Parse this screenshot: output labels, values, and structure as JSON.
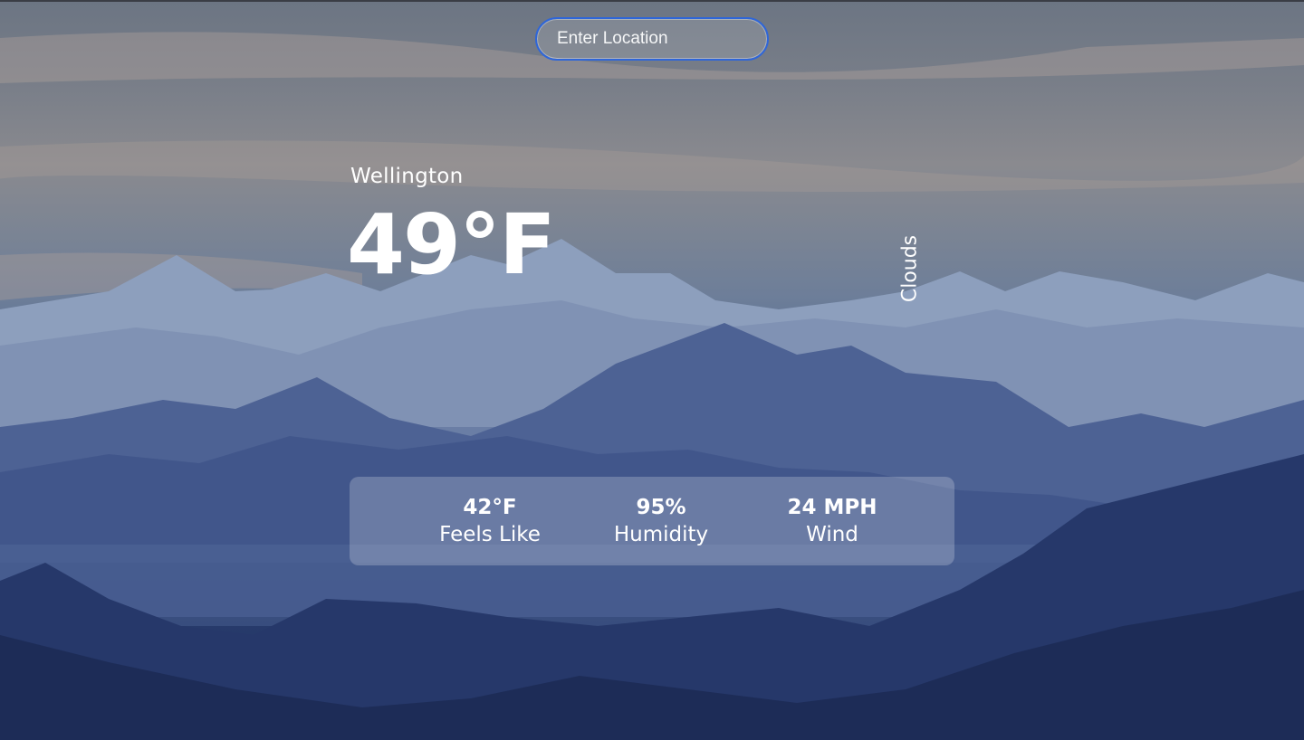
{
  "search": {
    "placeholder": "Enter Location"
  },
  "weather": {
    "location": "Wellington",
    "temperature": "49°F",
    "condition": "Clouds"
  },
  "details": [
    {
      "value": "42°F",
      "label": "Feels Like"
    },
    {
      "value": "95%",
      "label": "Humidity"
    },
    {
      "value": "24 MPH",
      "label": "Wind"
    }
  ],
  "colors": {
    "text": "#ffffff",
    "search_border": "#2f66d8",
    "panel": "rgba(255,255,255,0.22)"
  }
}
